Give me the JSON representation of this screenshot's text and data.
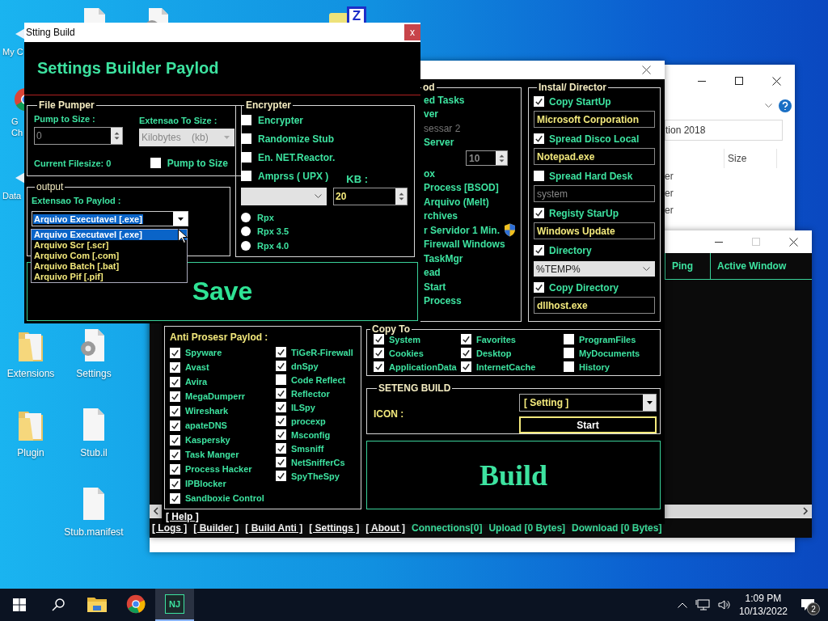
{
  "desktop": {
    "top_icons": [
      {
        "kind": "file"
      },
      {
        "kind": "settings"
      },
      {
        "kind": "archive",
        "badge": "Z"
      }
    ],
    "cut_icons": [
      {
        "kind": "shortcut",
        "lines": [
          "My C"
        ]
      },
      {
        "kind": "chrome",
        "lines": [
          "G",
          "Ch"
        ]
      },
      {
        "kind": "shortcut",
        "lines": [
          "Data"
        ]
      }
    ],
    "icons": [
      {
        "kind": "folder",
        "label": "Extensions"
      },
      {
        "kind": "settings",
        "label": "Settings"
      },
      {
        "kind": "folder",
        "label": "Plugin"
      },
      {
        "kind": "file",
        "label": "Stub.il"
      },
      {
        "kind": "file",
        "label": "Stub.manifest"
      }
    ]
  },
  "explorer_window": {
    "search_text": "tion 2018",
    "column": "Size",
    "rows": [
      "er",
      "er",
      "er"
    ]
  },
  "client_window": {
    "columns": [
      "Ping",
      "Active Window"
    ],
    "nav_links": [
      "[ Logs ]",
      "[ Builder ]",
      "[ Build Anti ]",
      "[ Settings ]",
      "[ About ]"
    ],
    "status": [
      "Connections[0]",
      "Upload [0 Bytes]",
      "Download [0 Bytes]"
    ]
  },
  "builder_window": {
    "payload_group": {
      "title": "od",
      "items": [
        {
          "kind": "text",
          "label": "ed Tasks",
          "disabled": false,
          "shield": false
        },
        {
          "kind": "text",
          "label": "ver",
          "disabled": false,
          "shield": false
        },
        {
          "kind": "text",
          "label": "sessar 2",
          "disabled": true,
          "shield": false
        },
        {
          "kind": "text",
          "label": "Server",
          "disabled": false,
          "shield": false
        },
        {
          "kind": "spinner",
          "label": "10",
          "disabled": true,
          "shield": false
        },
        {
          "kind": "text",
          "label": "ox",
          "disabled": false,
          "shield": false
        },
        {
          "kind": "text",
          "label": "Process [BSOD]",
          "disabled": false,
          "shield": false
        },
        {
          "kind": "text",
          "label": "Arquivo (Melt)",
          "disabled": false,
          "shield": false
        },
        {
          "kind": "text",
          "label": "rchives",
          "disabled": false,
          "shield": false
        },
        {
          "kind": "text",
          "label": "r Servidor 1 Min.",
          "disabled": false,
          "shield": true
        },
        {
          "kind": "text",
          "label": "Firewall Windows",
          "disabled": false,
          "shield": false
        },
        {
          "kind": "text",
          "label": "TaskMgr",
          "disabled": false,
          "shield": false
        },
        {
          "kind": "text",
          "label": "ead",
          "disabled": false,
          "shield": false
        },
        {
          "kind": "text",
          "label": "Start",
          "disabled": false,
          "shield": false
        },
        {
          "kind": "text",
          "label": "Process",
          "disabled": false,
          "shield": false
        }
      ]
    },
    "install_group": {
      "title": "Instal/ Director",
      "items": [
        {
          "kind": "check",
          "label": "Copy StartUp",
          "checked": true
        },
        {
          "kind": "field",
          "value": "Microsoft Corporation",
          "disabled": false
        },
        {
          "kind": "check",
          "label": "Spread Disco Local",
          "checked": true
        },
        {
          "kind": "field",
          "value": "Notepad.exe",
          "disabled": false
        },
        {
          "kind": "check",
          "label": "Spread  Hard Desk",
          "checked": false
        },
        {
          "kind": "field",
          "value": "system",
          "disabled": true
        },
        {
          "kind": "check",
          "label": "Registy StarUp",
          "checked": true
        },
        {
          "kind": "field",
          "value": "Windows Update",
          "disabled": false
        },
        {
          "kind": "check",
          "label": "Directory",
          "checked": true
        },
        {
          "kind": "dropdown",
          "value": "%TEMP%"
        },
        {
          "kind": "check",
          "label": "Copy Directory",
          "checked": true
        },
        {
          "kind": "field",
          "value": "dllhost.exe",
          "disabled": false
        }
      ]
    },
    "anti_group": {
      "title": "Anti Prosesr Paylod :",
      "columns": [
        {
          "items": [
            {
              "label": "Spyware",
              "checked": true
            },
            {
              "label": "Avast",
              "checked": true
            },
            {
              "label": "Avira",
              "checked": true
            },
            {
              "label": "MegaDumperr",
              "checked": true
            },
            {
              "label": "Wireshark",
              "checked": true
            },
            {
              "label": "apateDNS",
              "checked": true
            },
            {
              "label": "Kaspersky",
              "checked": true
            },
            {
              "label": "Task Manger",
              "checked": true
            },
            {
              "label": "Process Hacker",
              "checked": true
            },
            {
              "label": "IPBlocker",
              "checked": true
            },
            {
              "label": "Sandboxie Control",
              "checked": true
            }
          ]
        },
        {
          "items": [
            {
              "label": "TiGeR-Firewall",
              "checked": true
            },
            {
              "label": "dnSpy",
              "checked": true
            },
            {
              "label": "Code Reflect",
              "checked": false
            },
            {
              "label": "Reflector",
              "checked": true
            },
            {
              "label": "ILSpy",
              "checked": true
            },
            {
              "label": "procexp",
              "checked": true
            },
            {
              "label": "Msconfig",
              "checked": true
            },
            {
              "label": "Smsniff",
              "checked": true
            },
            {
              "label": "NetSnifferCs",
              "checked": true
            },
            {
              "label": "SpyTheSpy",
              "checked": true
            }
          ]
        }
      ]
    },
    "copy_to": {
      "title": "Copy To",
      "columns": [
        {
          "items": [
            {
              "label": "System",
              "checked": true
            },
            {
              "label": "Cookies",
              "checked": true
            },
            {
              "label": "ApplicationData",
              "checked": true
            }
          ]
        },
        {
          "items": [
            {
              "label": "Favorites",
              "checked": true
            },
            {
              "label": "Desktop",
              "checked": true
            },
            {
              "label": "InternetCache",
              "checked": true
            }
          ]
        },
        {
          "items": [
            {
              "label": "ProgramFiles",
              "checked": false
            },
            {
              "label": "MyDocuments",
              "checked": false
            },
            {
              "label": "History",
              "checked": false
            }
          ]
        }
      ]
    },
    "build_settings": {
      "title": "SETENG BUILD",
      "icon_label": "ICON :",
      "icon_value": "[ Setting  ]",
      "start_button": "Start"
    },
    "build_button": "Build",
    "help_link": "[ Help ]"
  },
  "settings_dialog": {
    "title": "Stting Build",
    "close": "x",
    "heading": "Settings Builder Paylod",
    "file_pumper": {
      "title": "File Pumper",
      "pump_label": "Pump to Size :",
      "pump_value": {
        "value": "0",
        "disabled": true
      },
      "size_label": "Extensao To Size :",
      "size_unit": {
        "value": "Kilobytes    (kb)",
        "disabled": true
      },
      "current_filesize": "Current Filesize: 0",
      "pump_check": {
        "label": "Pump to Size",
        "checked": false
      }
    },
    "output": {
      "title": "output",
      "label": "Extensao To Paylod :",
      "value": "Arquivo Executavel [.exe]",
      "options": [
        {
          "label": "Arquivo Executavel [.exe]",
          "selected": true
        },
        {
          "label": "Arquivo Scr [.scr]",
          "selected": false
        },
        {
          "label": "Arquivo Com [.com]",
          "selected": false
        },
        {
          "label": "Arquivo Batch [.bat]",
          "selected": false
        },
        {
          "label": "Arquivo Pif [.pif]",
          "selected": false
        }
      ]
    },
    "encrypter": {
      "title": "Encrypter",
      "options": [
        {
          "label": "Encrypter",
          "checked": false
        },
        {
          "label": "Randomize Stub",
          "checked": false
        },
        {
          "label": "En. NET.Reactor.",
          "checked": false
        },
        {
          "label": "Amprss ( UPX )",
          "checked": false
        }
      ],
      "kb_label": "KB :",
      "kb_value": "20",
      "versions": [
        {
          "label": "Rpx",
          "selected": false
        },
        {
          "label": "Rpx 3.5",
          "selected": false
        },
        {
          "label": "Rpx 4.0",
          "selected": false
        }
      ]
    },
    "save_button": "Save"
  },
  "taskbar": {
    "apps": [
      {
        "kind": "explorer",
        "selected": false
      },
      {
        "kind": "chrome",
        "selected": false
      },
      {
        "kind": "app",
        "label": "NJ",
        "selected": true
      }
    ],
    "time": "1:09 PM",
    "date": "10/13/2022",
    "notifications": "2"
  }
}
